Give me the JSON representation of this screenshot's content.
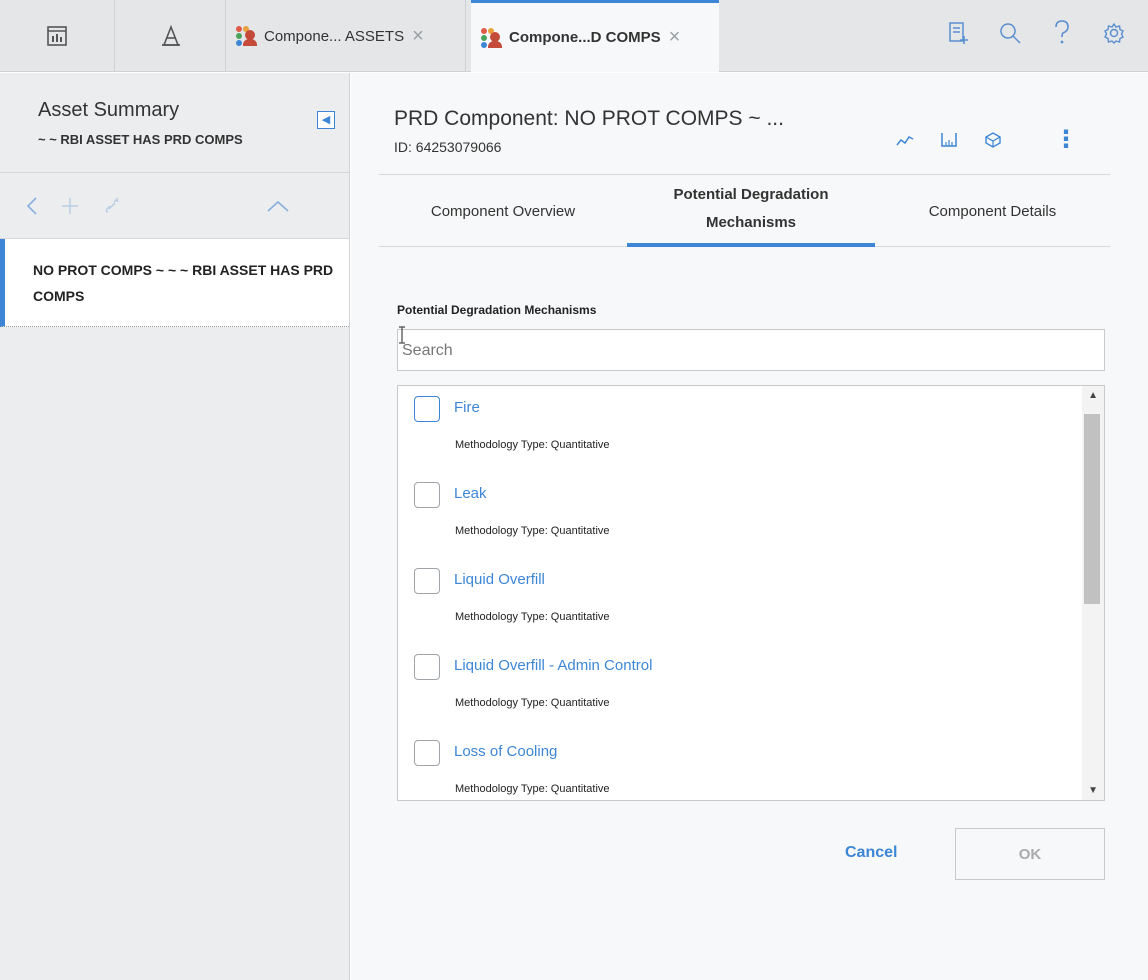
{
  "topbar": {
    "tabs": [
      {
        "label": "Compone... ASSETS"
      },
      {
        "label": "Compone...D COMPS"
      }
    ],
    "close_glyph": "×"
  },
  "left": {
    "title": "Asset Summary",
    "subtitle": "~ ~ RBI ASSET HAS PRD COMPS",
    "items": [
      {
        "label": "NO PROT COMPS ~ ~ ~ RBI ASSET HAS PRD COMPS"
      }
    ]
  },
  "record": {
    "title": "PRD Component: NO PROT COMPS ~ ...",
    "id": "ID: 64253079066"
  },
  "tabs": [
    {
      "label": "Component Overview"
    },
    {
      "label": "Potential Degradation Mechanisms"
    },
    {
      "label": "Component Details"
    }
  ],
  "mechanisms": {
    "section_label": "Potential Degradation Mechanisms",
    "search_placeholder": "Search",
    "items": [
      {
        "name": "Fire",
        "type": "Methodology Type: Quantitative"
      },
      {
        "name": "Leak",
        "type": "Methodology Type: Quantitative"
      },
      {
        "name": "Liquid Overfill",
        "type": "Methodology Type: Quantitative"
      },
      {
        "name": "Liquid Overfill - Admin Control",
        "type": "Methodology Type: Quantitative"
      },
      {
        "name": "Loss of Cooling",
        "type": "Methodology Type: Quantitative"
      }
    ]
  },
  "actions": {
    "cancel": "Cancel",
    "ok": "OK"
  },
  "colors": {
    "accent": "#3d86d6"
  }
}
